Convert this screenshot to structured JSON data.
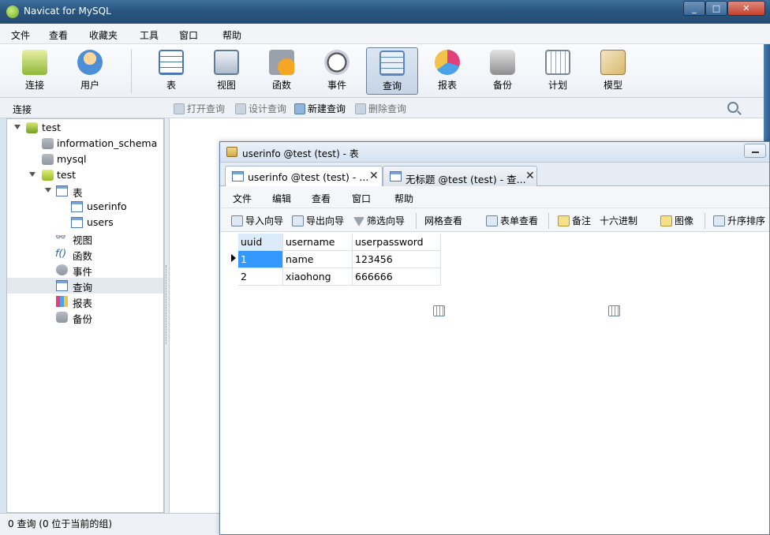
{
  "window": {
    "title": "Navicat for MySQL"
  },
  "menu": [
    "文件",
    "查看",
    "收藏夹",
    "工具",
    "窗口",
    "帮助"
  ],
  "toolbar": [
    {
      "label": "连接",
      "icon": "connection-icon"
    },
    {
      "label": "用户",
      "icon": "user-icon"
    },
    {
      "label": "表",
      "icon": "table-icon"
    },
    {
      "label": "视图",
      "icon": "view-icon"
    },
    {
      "label": "函数",
      "icon": "function-icon"
    },
    {
      "label": "事件",
      "icon": "event-icon"
    },
    {
      "label": "查询",
      "icon": "query-icon",
      "active": true
    },
    {
      "label": "报表",
      "icon": "report-icon"
    },
    {
      "label": "备份",
      "icon": "backup-icon"
    },
    {
      "label": "计划",
      "icon": "schedule-icon"
    },
    {
      "label": "模型",
      "icon": "model-icon"
    }
  ],
  "subbar": {
    "section_label": "连接",
    "actions": [
      {
        "label": "打开查询",
        "enabled": false
      },
      {
        "label": "设计查询",
        "enabled": false
      },
      {
        "label": "新建查询",
        "enabled": true
      },
      {
        "label": "删除查询",
        "enabled": false
      }
    ]
  },
  "tree": [
    {
      "label": "test",
      "icon": "connection-icon",
      "expanded": true
    },
    {
      "label": "information_schema",
      "icon": "database-icon"
    },
    {
      "label": "mysql",
      "icon": "database-icon"
    },
    {
      "label": "test",
      "icon": "database-open-icon",
      "expanded": true
    },
    {
      "label": "表",
      "icon": "tables-folder-icon",
      "expanded": true
    },
    {
      "label": "userinfo",
      "icon": "table-icon"
    },
    {
      "label": "users",
      "icon": "table-icon"
    },
    {
      "label": "视图",
      "icon": "views-folder-icon"
    },
    {
      "label": "函数",
      "icon": "functions-folder-icon"
    },
    {
      "label": "事件",
      "icon": "events-folder-icon"
    },
    {
      "label": "查询",
      "icon": "queries-folder-icon",
      "selected": true
    },
    {
      "label": "报表",
      "icon": "reports-folder-icon"
    },
    {
      "label": "备份",
      "icon": "backups-folder-icon"
    }
  ],
  "status": "0 查询 (0 位于当前的组)",
  "child": {
    "title": "userinfo @test (test) - 表",
    "tabs": [
      {
        "label": "userinfo @test (test) - ...",
        "active": true
      },
      {
        "label": "无标题 @test (test) - 查...",
        "active": false
      }
    ],
    "menu": [
      "文件",
      "编辑",
      "查看",
      "窗口",
      "帮助"
    ],
    "tools": [
      "导入向导",
      "导出向导",
      "筛选向导",
      "网格查看",
      "表单查看",
      "备注",
      "十六进制",
      "图像",
      "升序排序"
    ],
    "grid": {
      "columns": [
        "uuid",
        "username",
        "userpassword"
      ],
      "rows": [
        [
          "1",
          "name",
          "123456"
        ],
        [
          "2",
          "xiaohong",
          "666666"
        ]
      ]
    }
  },
  "colors": {
    "accent": "#3399ff",
    "titlebar": "#2b5680"
  }
}
